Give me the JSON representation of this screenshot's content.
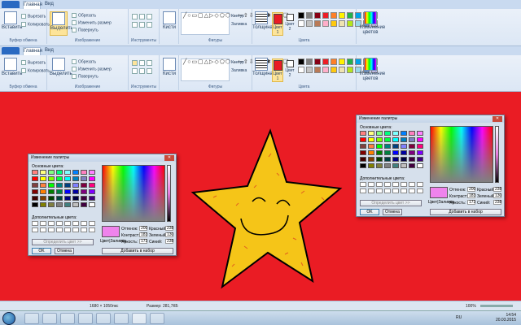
{
  "ribbon": {
    "tabs": {
      "file": "",
      "home": "Главная",
      "view": "Вид"
    },
    "clipboard": {
      "paste": "Вставить",
      "cut": "Вырезать",
      "copy": "Копировать",
      "group": "Буфер обмена"
    },
    "image": {
      "select": "Выделить",
      "crop": "Обрезать",
      "resize": "Изменить размер",
      "rotate": "Повернуть",
      "group": "Изображение"
    },
    "tools": {
      "group": "Инструменты"
    },
    "brushes": {
      "label": "Кисти"
    },
    "shapes": {
      "glyphs": "╱○▭▢△▷◇⬠⬡→⇦⇧⇩☆✦✱❏❍❏",
      "outline": "Контур",
      "fill": "Заливка",
      "group": "Фигуры"
    },
    "size": {
      "label": "Толщина"
    },
    "color1": {
      "label": "Цвет 1",
      "value": "#ea1c24"
    },
    "color2": {
      "label": "Цвет 2",
      "value": "#ffffff"
    },
    "colors_group": "Цвета",
    "edit_colors": "Изменение цветов",
    "palette": [
      "#000000",
      "#7f7f7f",
      "#880015",
      "#ed1c24",
      "#ff7f27",
      "#fff200",
      "#22b14c",
      "#00a2e8",
      "#3f48cc",
      "#a349a4",
      "#ffffff",
      "#c3c3c3",
      "#b97a57",
      "#ffaec9",
      "#ffc90e",
      "#efe4b0",
      "#b5e61d",
      "#99d9ea",
      "#7092be",
      "#c8bfe7"
    ]
  },
  "dialog": {
    "title": "Изменение палитры",
    "basic_colors": "Основные цвета:",
    "custom_colors": "Дополнительные цвета:",
    "define": "Определить цвет >>",
    "ok": "OK",
    "cancel": "Отмена",
    "add": "Добавить в набор",
    "solid": "Цвет|Заливка",
    "hue_label": "Оттенок:",
    "hue": "200",
    "sat_label": "Контраст:",
    "sat": "183",
    "lum_label": "Яркость:",
    "lum": "173",
    "red_label": "Красный:",
    "red": "238",
    "green_label": "Зеленый:",
    "green": "130",
    "blue_label": "Синий:",
    "blue": "238",
    "preview_color": "#ef83ec",
    "swatches": [
      "#ff8080",
      "#ffff80",
      "#80ff80",
      "#00ff80",
      "#80ffff",
      "#0080ff",
      "#ff80c0",
      "#ff80ff",
      "#ff0000",
      "#ffff00",
      "#80ff00",
      "#00ff40",
      "#00ffff",
      "#0080c0",
      "#8080c0",
      "#ff00ff",
      "#804040",
      "#ff8040",
      "#00ff00",
      "#008080",
      "#004080",
      "#8080ff",
      "#800040",
      "#ff0080",
      "#800000",
      "#ff8000",
      "#008000",
      "#008040",
      "#0000ff",
      "#0000a0",
      "#800080",
      "#8000ff",
      "#400000",
      "#804000",
      "#004000",
      "#004040",
      "#000080",
      "#000040",
      "#400040",
      "#400080",
      "#000000",
      "#808000",
      "#808040",
      "#808080",
      "#408080",
      "#c0c0c0",
      "#400040",
      "#ffffff"
    ]
  },
  "status": {
    "dims": "1680 × 1050пкс",
    "size": "Размер: 281,7КБ",
    "zoom": "100%"
  },
  "taskbar": {
    "time": "14:54",
    "date": "20.03.2015",
    "lang": "RU"
  }
}
